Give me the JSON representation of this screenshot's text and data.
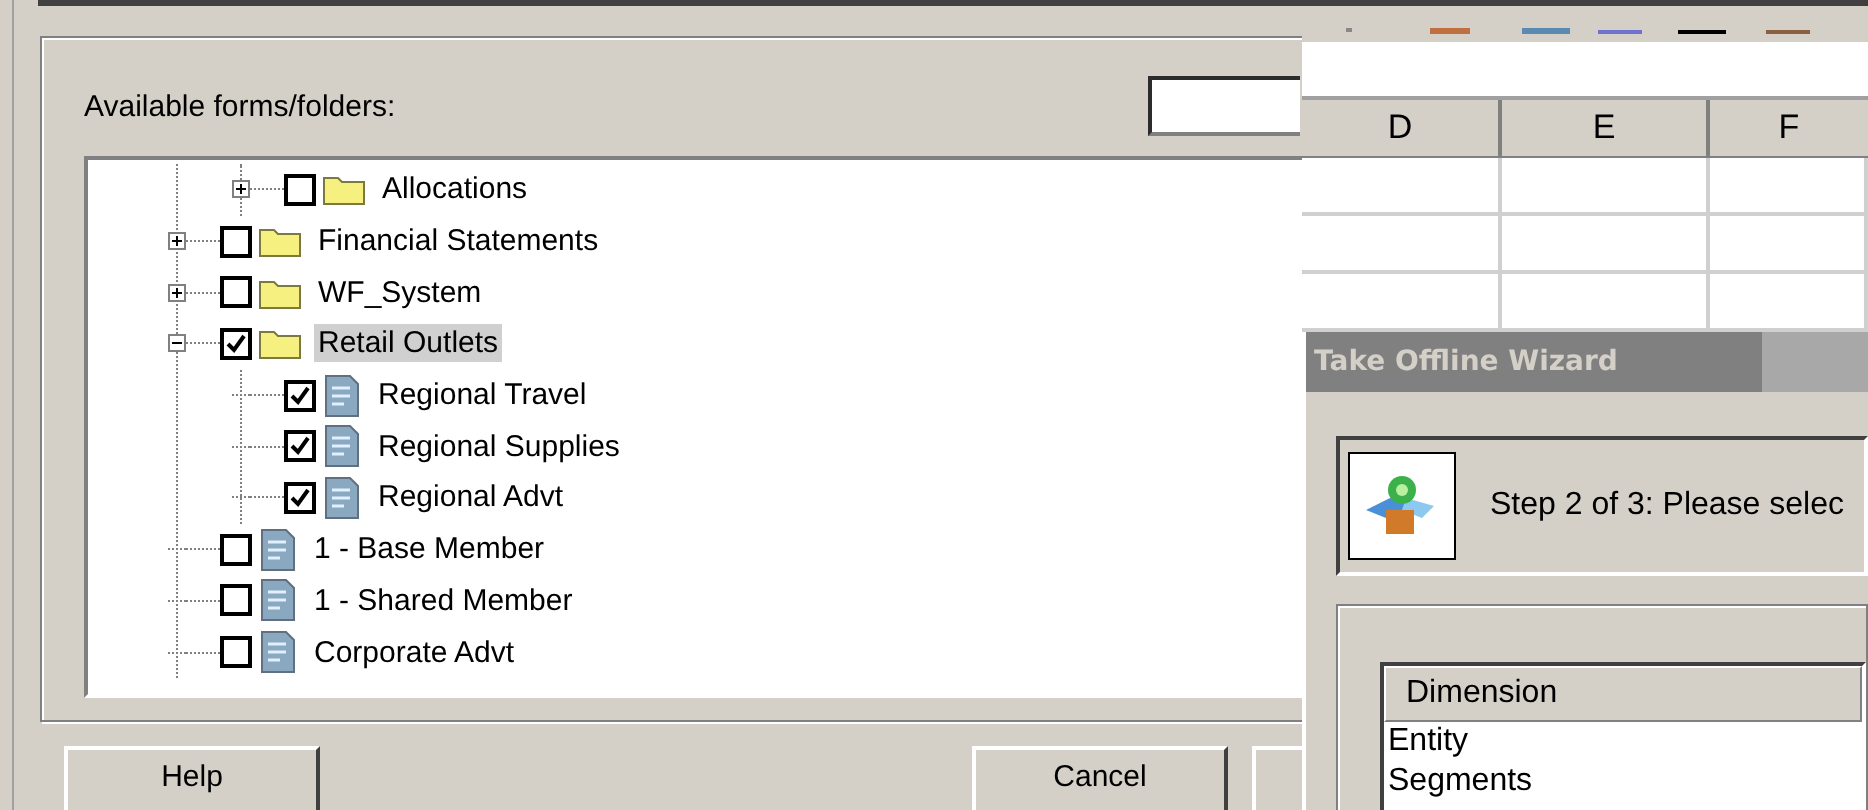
{
  "dialog": {
    "section_label": "Available forms/folders:",
    "tree": {
      "partial_branch": [
        {
          "label": "Allocations",
          "kind": "folder",
          "checked": false,
          "selected": false,
          "expanded": false
        }
      ],
      "items": [
        {
          "label": "Financial Statements",
          "kind": "folder",
          "checked": false,
          "selected": false,
          "expanded": false
        },
        {
          "label": "WF_System",
          "kind": "folder",
          "checked": false,
          "selected": false,
          "expanded": false
        },
        {
          "label": "Retail Outlets",
          "kind": "folder",
          "checked": true,
          "selected": true,
          "expanded": true,
          "children": [
            {
              "label": "Regional Travel",
              "kind": "form",
              "checked": true,
              "selected": false
            },
            {
              "label": "Regional Supplies",
              "kind": "form",
              "checked": true,
              "selected": false
            },
            {
              "label": "Regional Advt",
              "kind": "form",
              "checked": true,
              "selected": false
            }
          ]
        },
        {
          "label": "1 - Base Member",
          "kind": "form",
          "checked": false,
          "selected": false
        },
        {
          "label": "1 - Shared Member",
          "kind": "form",
          "checked": false,
          "selected": false
        },
        {
          "label": "Corporate Advt",
          "kind": "form",
          "checked": false,
          "selected": false
        }
      ]
    },
    "buttons": [
      "Help",
      "Cancel"
    ]
  },
  "spreadsheet": {
    "columns": [
      "D",
      "E",
      "F"
    ]
  },
  "wizard": {
    "title": "Take Offline Wizard",
    "active": false,
    "step_text": "Step 2 of 3: Please selec",
    "list": {
      "column": "Dimension",
      "rows": [
        "Entity",
        "Segments"
      ]
    }
  }
}
